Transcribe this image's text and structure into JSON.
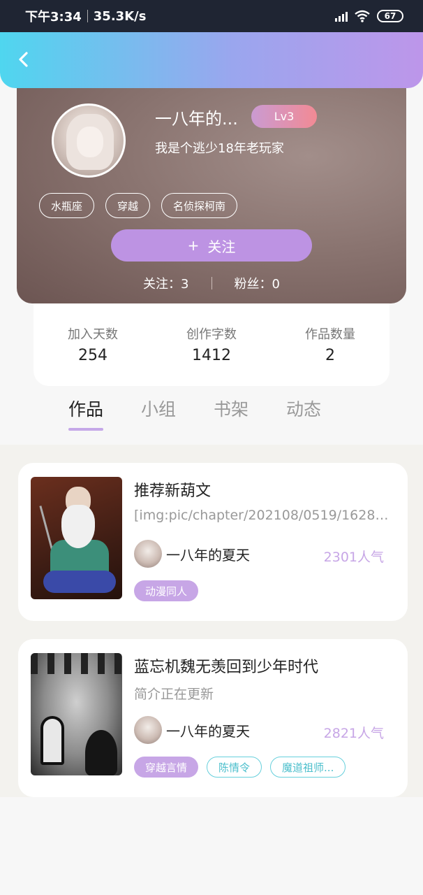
{
  "status_bar": {
    "time": "下午3:34",
    "speed": "35.3K/s",
    "battery": "67"
  },
  "profile": {
    "username": "一八年的...",
    "level": "Lv3",
    "bio": "我是个逃少18年老玩家",
    "tags": [
      "水瓶座",
      "穿越",
      "名侦探柯南"
    ],
    "follow_label": "关注",
    "follow_icon": "+",
    "following_label": "关注：3",
    "followers_label": "粉丝：0"
  },
  "stats": [
    {
      "label": "加入天数",
      "value": "254"
    },
    {
      "label": "创作字数",
      "value": "1412"
    },
    {
      "label": "作品数量",
      "value": "2"
    }
  ],
  "tabs": [
    "作品",
    "小组",
    "书架",
    "动态"
  ],
  "works": [
    {
      "title": "推荐新葫文",
      "description": "[img:pic/chapter/202108/0519/162816...",
      "author": "一八年的夏天",
      "popularity": "2301人气",
      "tags": [
        {
          "label": "动漫同人",
          "style": "filled"
        }
      ]
    },
    {
      "title": "蓝忘机魏无羡回到少年时代",
      "description": "简介正在更新",
      "author": "一八年的夏天",
      "popularity": "2821人气",
      "tags": [
        {
          "label": "穿越言情",
          "style": "filled"
        },
        {
          "label": "陈情令",
          "style": "outline"
        },
        {
          "label": "魔道祖师...",
          "style": "outline"
        }
      ]
    }
  ],
  "colors": {
    "accent": "#bd93e3",
    "header_start": "#4fd6ef",
    "header_end": "#bd96ea",
    "popularity": "#c7a6e6",
    "tag_outline": "#67d0dc"
  }
}
